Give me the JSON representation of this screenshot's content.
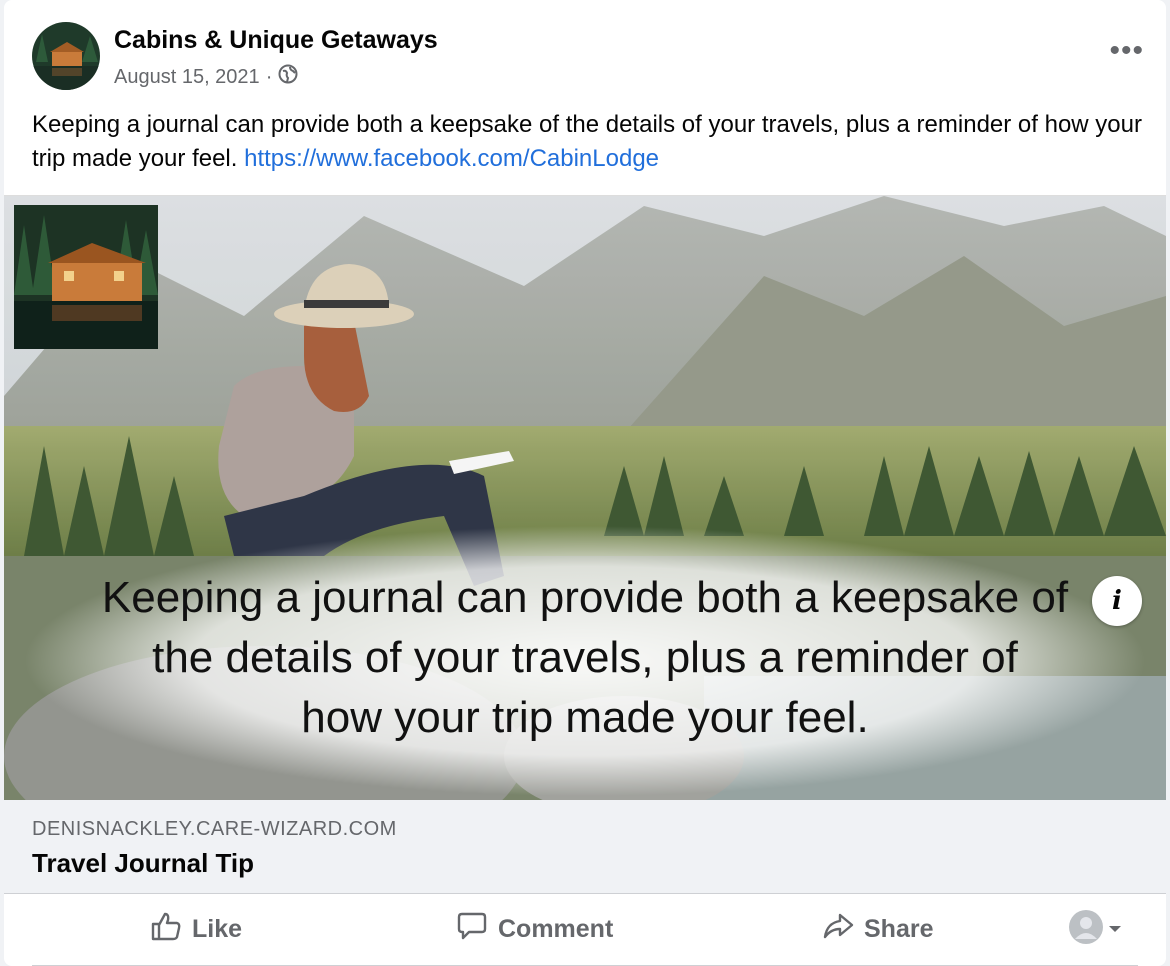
{
  "post": {
    "page_name": "Cabins & Unique Getaways",
    "date": "August 15, 2021",
    "separator": "·",
    "audience_icon": "globe-icon",
    "more_label": "•••",
    "text": "Keeping a journal can provide both a keepsake of the details of your travels, plus a reminder of how your trip made your feel.",
    "link_text": "https://www.facebook.com/CabinLodge"
  },
  "image": {
    "overlay_line1": "Keeping a journal can provide both a keepsake of",
    "overlay_line2": "the details of your travels, plus a reminder of",
    "overlay_line3": "how your trip made your feel.",
    "info_label": "i"
  },
  "link_preview": {
    "domain": "DENISNACKLEY.CARE-WIZARD.COM",
    "title": "Travel Journal Tip"
  },
  "actions": {
    "like": "Like",
    "comment": "Comment",
    "share": "Share"
  },
  "colors": {
    "link": "#216fdb",
    "secondary_text": "#65676b",
    "preview_bg": "#f0f2f5"
  }
}
